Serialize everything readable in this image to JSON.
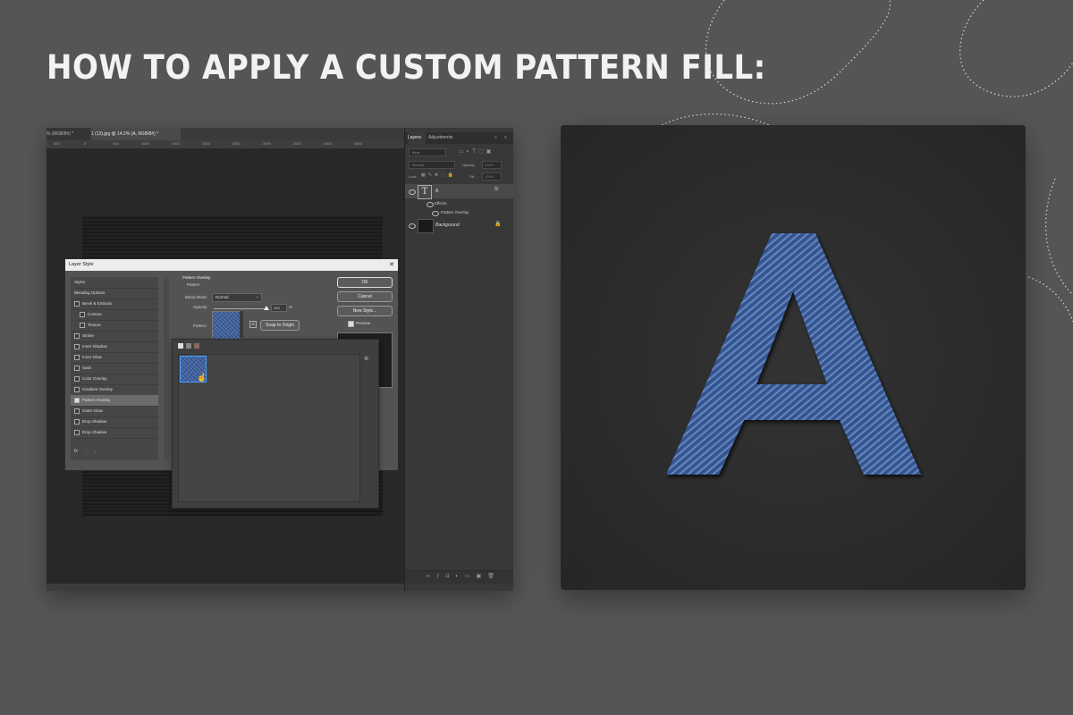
{
  "headline": "HOW TO APPLY A CUSTOM PATTERN FILL:",
  "colors": {
    "background": "#555555",
    "denim": "#3a5d9a",
    "card": "#2c2c2c"
  },
  "photoshop": {
    "tabs": [
      {
        "label": "% (RGB/8#) *"
      },
      {
        "label": "1 (13).jpg @ 14.2% (A, RGB/8#) *"
      }
    ],
    "ruler_labels": [
      "500",
      "0",
      "500",
      "1000",
      "1500",
      "2000",
      "2500",
      "3000",
      "3500",
      "4000",
      "4500"
    ],
    "layers_panel": {
      "tabs": [
        "Layers",
        "Adjustments"
      ],
      "search_placeholder": "Kind",
      "blend_mode": "Normal",
      "opacity_label": "Opacity:",
      "opacity_value": "100%",
      "lock_label": "Lock:",
      "fill_label": "Fill:",
      "fill_value": "100%",
      "layers": [
        {
          "name": "A",
          "fx": "fx",
          "effects_label": "Effects",
          "effect": "Pattern Overlay"
        },
        {
          "name": "Background"
        }
      ]
    },
    "layer_style_dialog": {
      "title": "Layer Style",
      "styles": [
        {
          "label": "Styles"
        },
        {
          "label": "Blending Options"
        },
        {
          "label": "Bevel & Emboss",
          "checked": false
        },
        {
          "label": "Contour",
          "checked": false
        },
        {
          "label": "Texture",
          "checked": false
        },
        {
          "label": "Stroke",
          "checked": false
        },
        {
          "label": "Inner Shadow",
          "checked": false
        },
        {
          "label": "Inner Glow",
          "checked": false
        },
        {
          "label": "Satin",
          "checked": false
        },
        {
          "label": "Color Overlay",
          "checked": false
        },
        {
          "label": "Gradient Overlay",
          "checked": false
        },
        {
          "label": "Pattern Overlay",
          "checked": true
        },
        {
          "label": "Outer Glow",
          "checked": false
        },
        {
          "label": "Drop Shadow",
          "checked": false
        },
        {
          "label": "Drop Shadow",
          "checked": false
        }
      ],
      "section_title": "Pattern Overlay",
      "subsection": "Pattern",
      "blend_mode_label": "Blend Mode:",
      "blend_mode_value": "Normal",
      "opacity_label": "Opacity:",
      "opacity_value": "100",
      "opacity_unit": "%",
      "pattern_label": "Pattern:",
      "snap_button": "Snap to Origin",
      "ok_button": "OK",
      "cancel_button": "Cancel",
      "new_style_button": "New Style...",
      "preview_label": "Preview",
      "preview_checked": true,
      "footer_fx": "fx"
    }
  },
  "preview": {
    "letter": "A"
  }
}
